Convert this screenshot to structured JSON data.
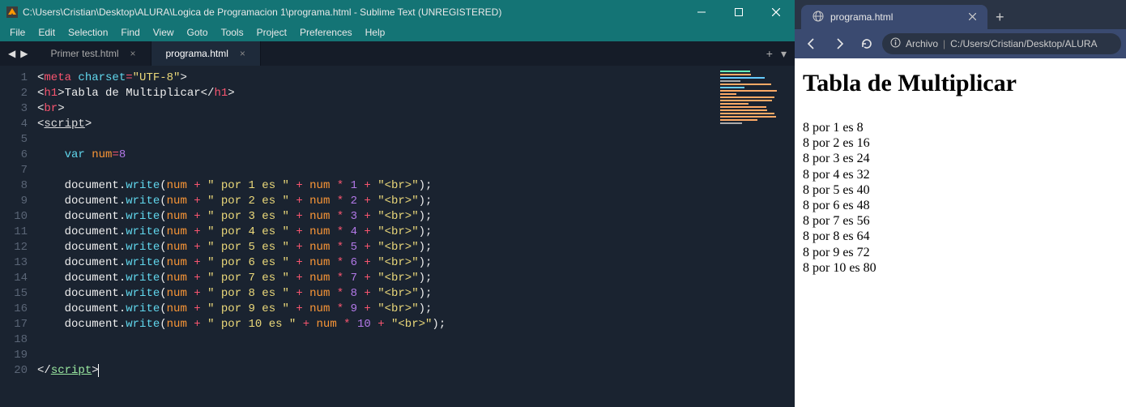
{
  "sublime": {
    "title": "C:\\Users\\Cristian\\Desktop\\ALURA\\Logica de Programacion 1\\programa.html - Sublime Text (UNREGISTERED)",
    "menu": [
      "File",
      "Edit",
      "Selection",
      "Find",
      "View",
      "Goto",
      "Tools",
      "Project",
      "Preferences",
      "Help"
    ],
    "tabs": [
      {
        "name": "Primer test.html",
        "active": false
      },
      {
        "name": "programa.html",
        "active": true
      }
    ],
    "code_lines": [
      {
        "n": "1",
        "tokens": [
          [
            "w",
            "<"
          ],
          [
            "tag",
            "meta"
          ],
          [
            "w",
            " "
          ],
          [
            "blue",
            "charset"
          ],
          [
            "red",
            "="
          ],
          [
            "str",
            "\"UTF-8\""
          ],
          [
            "w",
            ">"
          ]
        ]
      },
      {
        "n": "2",
        "tokens": [
          [
            "w",
            "<"
          ],
          [
            "tag",
            "h1"
          ],
          [
            "w",
            ">Tabla de Multiplicar</"
          ],
          [
            "tag",
            "h1"
          ],
          [
            "w",
            ">"
          ]
        ]
      },
      {
        "n": "3",
        "tokens": [
          [
            "w",
            "<"
          ],
          [
            "tag",
            "br"
          ],
          [
            "w",
            ">"
          ]
        ]
      },
      {
        "n": "4",
        "tokens": [
          [
            "w",
            "<"
          ],
          [
            "und",
            "script"
          ],
          [
            "w",
            ">"
          ]
        ]
      },
      {
        "n": "5",
        "tokens": []
      },
      {
        "n": "6",
        "tokens": [
          [
            "pad",
            "    "
          ],
          [
            "blue",
            "var"
          ],
          [
            "w",
            " "
          ],
          [
            "orange",
            "num"
          ],
          [
            "red",
            "="
          ],
          [
            "purple",
            "8"
          ]
        ]
      },
      {
        "n": "7",
        "tokens": []
      },
      {
        "n": "8",
        "tokens": [
          [
            "pad",
            "    "
          ],
          [
            "w",
            "document."
          ],
          [
            "blue",
            "write"
          ],
          [
            "w",
            "("
          ],
          [
            "orange",
            "num"
          ],
          [
            "w",
            " "
          ],
          [
            "red",
            "+"
          ],
          [
            "w",
            " "
          ],
          [
            "str",
            "\" por 1 es \""
          ],
          [
            "w",
            " "
          ],
          [
            "red",
            "+"
          ],
          [
            "w",
            " "
          ],
          [
            "orange",
            "num"
          ],
          [
            "w",
            " "
          ],
          [
            "red",
            "*"
          ],
          [
            "w",
            " "
          ],
          [
            "purple",
            "1"
          ],
          [
            "w",
            " "
          ],
          [
            "red",
            "+"
          ],
          [
            "w",
            " "
          ],
          [
            "str",
            "\"<br>\""
          ],
          [
            "w",
            ");"
          ]
        ]
      },
      {
        "n": "9",
        "tokens": [
          [
            "pad",
            "    "
          ],
          [
            "w",
            "document."
          ],
          [
            "blue",
            "write"
          ],
          [
            "w",
            "("
          ],
          [
            "orange",
            "num"
          ],
          [
            "w",
            " "
          ],
          [
            "red",
            "+"
          ],
          [
            "w",
            " "
          ],
          [
            "str",
            "\" por 2 es \""
          ],
          [
            "w",
            " "
          ],
          [
            "red",
            "+"
          ],
          [
            "w",
            " "
          ],
          [
            "orange",
            "num"
          ],
          [
            "w",
            " "
          ],
          [
            "red",
            "*"
          ],
          [
            "w",
            " "
          ],
          [
            "purple",
            "2"
          ],
          [
            "w",
            " "
          ],
          [
            "red",
            "+"
          ],
          [
            "w",
            " "
          ],
          [
            "str",
            "\"<br>\""
          ],
          [
            "w",
            ");"
          ]
        ]
      },
      {
        "n": "10",
        "tokens": [
          [
            "pad",
            "    "
          ],
          [
            "w",
            "document."
          ],
          [
            "blue",
            "write"
          ],
          [
            "w",
            "("
          ],
          [
            "orange",
            "num"
          ],
          [
            "w",
            " "
          ],
          [
            "red",
            "+"
          ],
          [
            "w",
            " "
          ],
          [
            "str",
            "\" por 3 es \""
          ],
          [
            "w",
            " "
          ],
          [
            "red",
            "+"
          ],
          [
            "w",
            " "
          ],
          [
            "orange",
            "num"
          ],
          [
            "w",
            " "
          ],
          [
            "red",
            "*"
          ],
          [
            "w",
            " "
          ],
          [
            "purple",
            "3"
          ],
          [
            "w",
            " "
          ],
          [
            "red",
            "+"
          ],
          [
            "w",
            " "
          ],
          [
            "str",
            "\"<br>\""
          ],
          [
            "w",
            ");"
          ]
        ]
      },
      {
        "n": "11",
        "tokens": [
          [
            "pad",
            "    "
          ],
          [
            "w",
            "document."
          ],
          [
            "blue",
            "write"
          ],
          [
            "w",
            "("
          ],
          [
            "orange",
            "num"
          ],
          [
            "w",
            " "
          ],
          [
            "red",
            "+"
          ],
          [
            "w",
            " "
          ],
          [
            "str",
            "\" por 4 es \""
          ],
          [
            "w",
            " "
          ],
          [
            "red",
            "+"
          ],
          [
            "w",
            " "
          ],
          [
            "orange",
            "num"
          ],
          [
            "w",
            " "
          ],
          [
            "red",
            "*"
          ],
          [
            "w",
            " "
          ],
          [
            "purple",
            "4"
          ],
          [
            "w",
            " "
          ],
          [
            "red",
            "+"
          ],
          [
            "w",
            " "
          ],
          [
            "str",
            "\"<br>\""
          ],
          [
            "w",
            ");"
          ]
        ]
      },
      {
        "n": "12",
        "tokens": [
          [
            "pad",
            "    "
          ],
          [
            "w",
            "document."
          ],
          [
            "blue",
            "write"
          ],
          [
            "w",
            "("
          ],
          [
            "orange",
            "num"
          ],
          [
            "w",
            " "
          ],
          [
            "red",
            "+"
          ],
          [
            "w",
            " "
          ],
          [
            "str",
            "\" por 5 es \""
          ],
          [
            "w",
            " "
          ],
          [
            "red",
            "+"
          ],
          [
            "w",
            " "
          ],
          [
            "orange",
            "num"
          ],
          [
            "w",
            " "
          ],
          [
            "red",
            "*"
          ],
          [
            "w",
            " "
          ],
          [
            "purple",
            "5"
          ],
          [
            "w",
            " "
          ],
          [
            "red",
            "+"
          ],
          [
            "w",
            " "
          ],
          [
            "str",
            "\"<br>\""
          ],
          [
            "w",
            ");"
          ]
        ]
      },
      {
        "n": "13",
        "tokens": [
          [
            "pad",
            "    "
          ],
          [
            "w",
            "document."
          ],
          [
            "blue",
            "write"
          ],
          [
            "w",
            "("
          ],
          [
            "orange",
            "num"
          ],
          [
            "w",
            " "
          ],
          [
            "red",
            "+"
          ],
          [
            "w",
            " "
          ],
          [
            "str",
            "\" por 6 es \""
          ],
          [
            "w",
            " "
          ],
          [
            "red",
            "+"
          ],
          [
            "w",
            " "
          ],
          [
            "orange",
            "num"
          ],
          [
            "w",
            " "
          ],
          [
            "red",
            "*"
          ],
          [
            "w",
            " "
          ],
          [
            "purple",
            "6"
          ],
          [
            "w",
            " "
          ],
          [
            "red",
            "+"
          ],
          [
            "w",
            " "
          ],
          [
            "str",
            "\"<br>\""
          ],
          [
            "w",
            ");"
          ]
        ]
      },
      {
        "n": "14",
        "tokens": [
          [
            "pad",
            "    "
          ],
          [
            "w",
            "document."
          ],
          [
            "blue",
            "write"
          ],
          [
            "w",
            "("
          ],
          [
            "orange",
            "num"
          ],
          [
            "w",
            " "
          ],
          [
            "red",
            "+"
          ],
          [
            "w",
            " "
          ],
          [
            "str",
            "\" por 7 es \""
          ],
          [
            "w",
            " "
          ],
          [
            "red",
            "+"
          ],
          [
            "w",
            " "
          ],
          [
            "orange",
            "num"
          ],
          [
            "w",
            " "
          ],
          [
            "red",
            "*"
          ],
          [
            "w",
            " "
          ],
          [
            "purple",
            "7"
          ],
          [
            "w",
            " "
          ],
          [
            "red",
            "+"
          ],
          [
            "w",
            " "
          ],
          [
            "str",
            "\"<br>\""
          ],
          [
            "w",
            ");"
          ]
        ]
      },
      {
        "n": "15",
        "tokens": [
          [
            "pad",
            "    "
          ],
          [
            "w",
            "document."
          ],
          [
            "blue",
            "write"
          ],
          [
            "w",
            "("
          ],
          [
            "orange",
            "num"
          ],
          [
            "w",
            " "
          ],
          [
            "red",
            "+"
          ],
          [
            "w",
            " "
          ],
          [
            "str",
            "\" por 8 es \""
          ],
          [
            "w",
            " "
          ],
          [
            "red",
            "+"
          ],
          [
            "w",
            " "
          ],
          [
            "orange",
            "num"
          ],
          [
            "w",
            " "
          ],
          [
            "red",
            "*"
          ],
          [
            "w",
            " "
          ],
          [
            "purple",
            "8"
          ],
          [
            "w",
            " "
          ],
          [
            "red",
            "+"
          ],
          [
            "w",
            " "
          ],
          [
            "str",
            "\"<br>\""
          ],
          [
            "w",
            ");"
          ]
        ]
      },
      {
        "n": "16",
        "tokens": [
          [
            "pad",
            "    "
          ],
          [
            "w",
            "document."
          ],
          [
            "blue",
            "write"
          ],
          [
            "w",
            "("
          ],
          [
            "orange",
            "num"
          ],
          [
            "w",
            " "
          ],
          [
            "red",
            "+"
          ],
          [
            "w",
            " "
          ],
          [
            "str",
            "\" por 9 es \""
          ],
          [
            "w",
            " "
          ],
          [
            "red",
            "+"
          ],
          [
            "w",
            " "
          ],
          [
            "orange",
            "num"
          ],
          [
            "w",
            " "
          ],
          [
            "red",
            "*"
          ],
          [
            "w",
            " "
          ],
          [
            "purple",
            "9"
          ],
          [
            "w",
            " "
          ],
          [
            "red",
            "+"
          ],
          [
            "w",
            " "
          ],
          [
            "str",
            "\"<br>\""
          ],
          [
            "w",
            ");"
          ]
        ]
      },
      {
        "n": "17",
        "tokens": [
          [
            "pad",
            "    "
          ],
          [
            "w",
            "document."
          ],
          [
            "blue",
            "write"
          ],
          [
            "w",
            "("
          ],
          [
            "orange",
            "num"
          ],
          [
            "w",
            " "
          ],
          [
            "red",
            "+"
          ],
          [
            "w",
            " "
          ],
          [
            "str",
            "\" por 10 es \""
          ],
          [
            "w",
            " "
          ],
          [
            "red",
            "+"
          ],
          [
            "w",
            " "
          ],
          [
            "orange",
            "num"
          ],
          [
            "w",
            " "
          ],
          [
            "red",
            "*"
          ],
          [
            "w",
            " "
          ],
          [
            "purple",
            "10"
          ],
          [
            "w",
            " "
          ],
          [
            "red",
            "+"
          ],
          [
            "w",
            " "
          ],
          [
            "str",
            "\"<br>\""
          ],
          [
            "w",
            ");"
          ]
        ]
      },
      {
        "n": "18",
        "tokens": []
      },
      {
        "n": "19",
        "tokens": []
      },
      {
        "n": "20",
        "tokens": [
          [
            "w",
            "</"
          ],
          [
            "usr",
            "script"
          ],
          [
            "w",
            ">"
          ]
        ],
        "caret": true
      }
    ]
  },
  "browser": {
    "tab_title": "programa.html",
    "url_label": "Archivo",
    "url_path": "C:/Users/Cristian/Desktop/ALURA",
    "page_title": "Tabla de Multiplicar",
    "output": [
      "8 por 1 es 8",
      "8 por 2 es 16",
      "8 por 3 es 24",
      "8 por 4 es 32",
      "8 por 5 es 40",
      "8 por 6 es 48",
      "8 por 7 es 56",
      "8 por 8 es 64",
      "8 por 9 es 72",
      "8 por 10 es 80"
    ]
  }
}
